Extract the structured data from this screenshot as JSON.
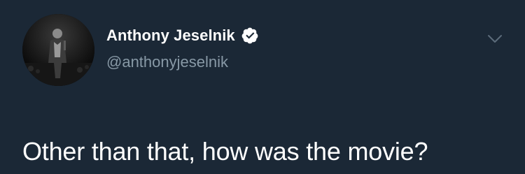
{
  "tweet": {
    "author": {
      "display_name": "Anthony Jeselnik",
      "handle": "@anthonyjeselnik",
      "verified": true
    },
    "text": "Other than that, how was the movie?"
  },
  "icons": {
    "verified": "verified-badge-icon",
    "menu": "chevron-down-icon"
  },
  "colors": {
    "background": "#1b2836",
    "primary_text": "#ffffff",
    "secondary_text": "#8899a6"
  }
}
